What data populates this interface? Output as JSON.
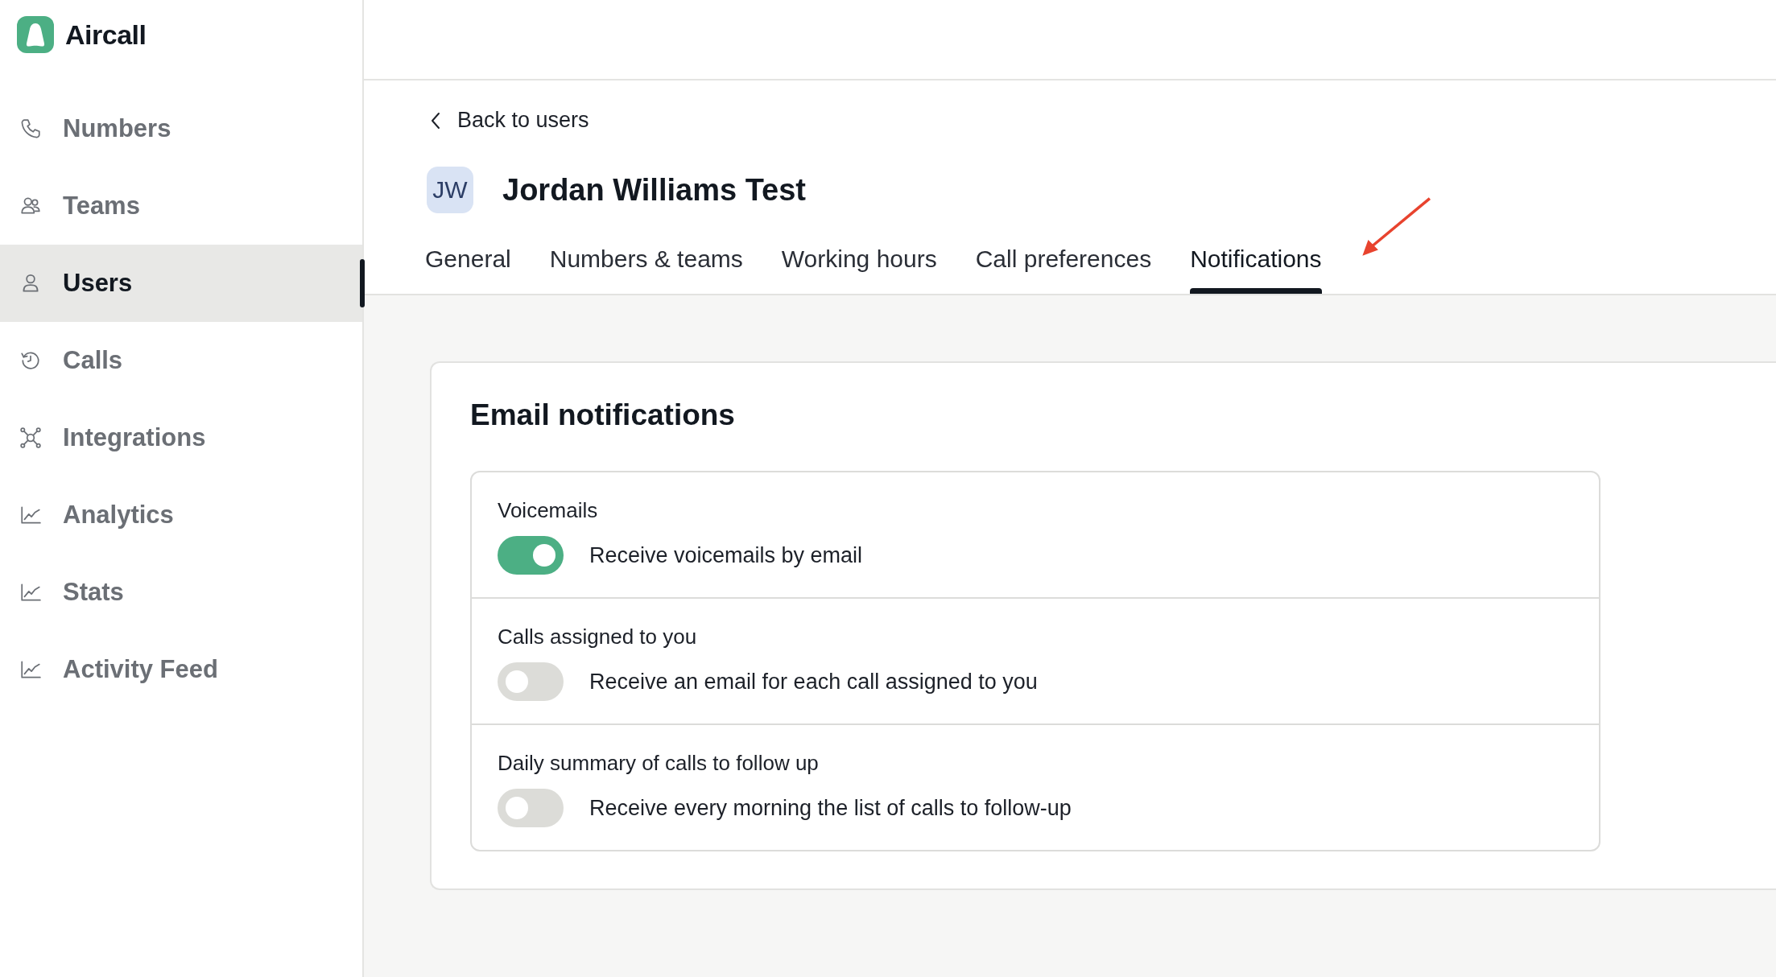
{
  "app": {
    "name": "Aircall"
  },
  "sidebar": {
    "items": [
      {
        "label": "Numbers",
        "kind": "phone",
        "selected": false
      },
      {
        "label": "Teams",
        "kind": "team",
        "selected": false
      },
      {
        "label": "Users",
        "kind": "user",
        "selected": true
      },
      {
        "label": "Calls",
        "kind": "history",
        "selected": false
      },
      {
        "label": "Integrations",
        "kind": "network",
        "selected": false
      },
      {
        "label": "Analytics",
        "kind": "chart",
        "selected": false
      },
      {
        "label": "Stats",
        "kind": "chart",
        "selected": false
      },
      {
        "label": "Activity Feed",
        "kind": "chart",
        "selected": false
      }
    ]
  },
  "back_link": "Back to users",
  "user": {
    "initials": "JW",
    "name": "Jordan Williams Test"
  },
  "tabs": [
    {
      "label": "General",
      "selected": false
    },
    {
      "label": "Numbers & teams",
      "selected": false
    },
    {
      "label": "Working hours",
      "selected": false
    },
    {
      "label": "Call preferences",
      "selected": false
    },
    {
      "label": "Notifications",
      "selected": true
    }
  ],
  "section": {
    "title": "Email notifications",
    "settings": [
      {
        "title": "Voicemails",
        "label": "Receive voicemails by email",
        "on": true
      },
      {
        "title": "Calls assigned to you",
        "label": "Receive an email for each call assigned to you",
        "on": false
      },
      {
        "title": "Daily summary of calls to follow up",
        "label": "Receive every morning the list of calls to follow-up",
        "on": false
      }
    ]
  }
}
